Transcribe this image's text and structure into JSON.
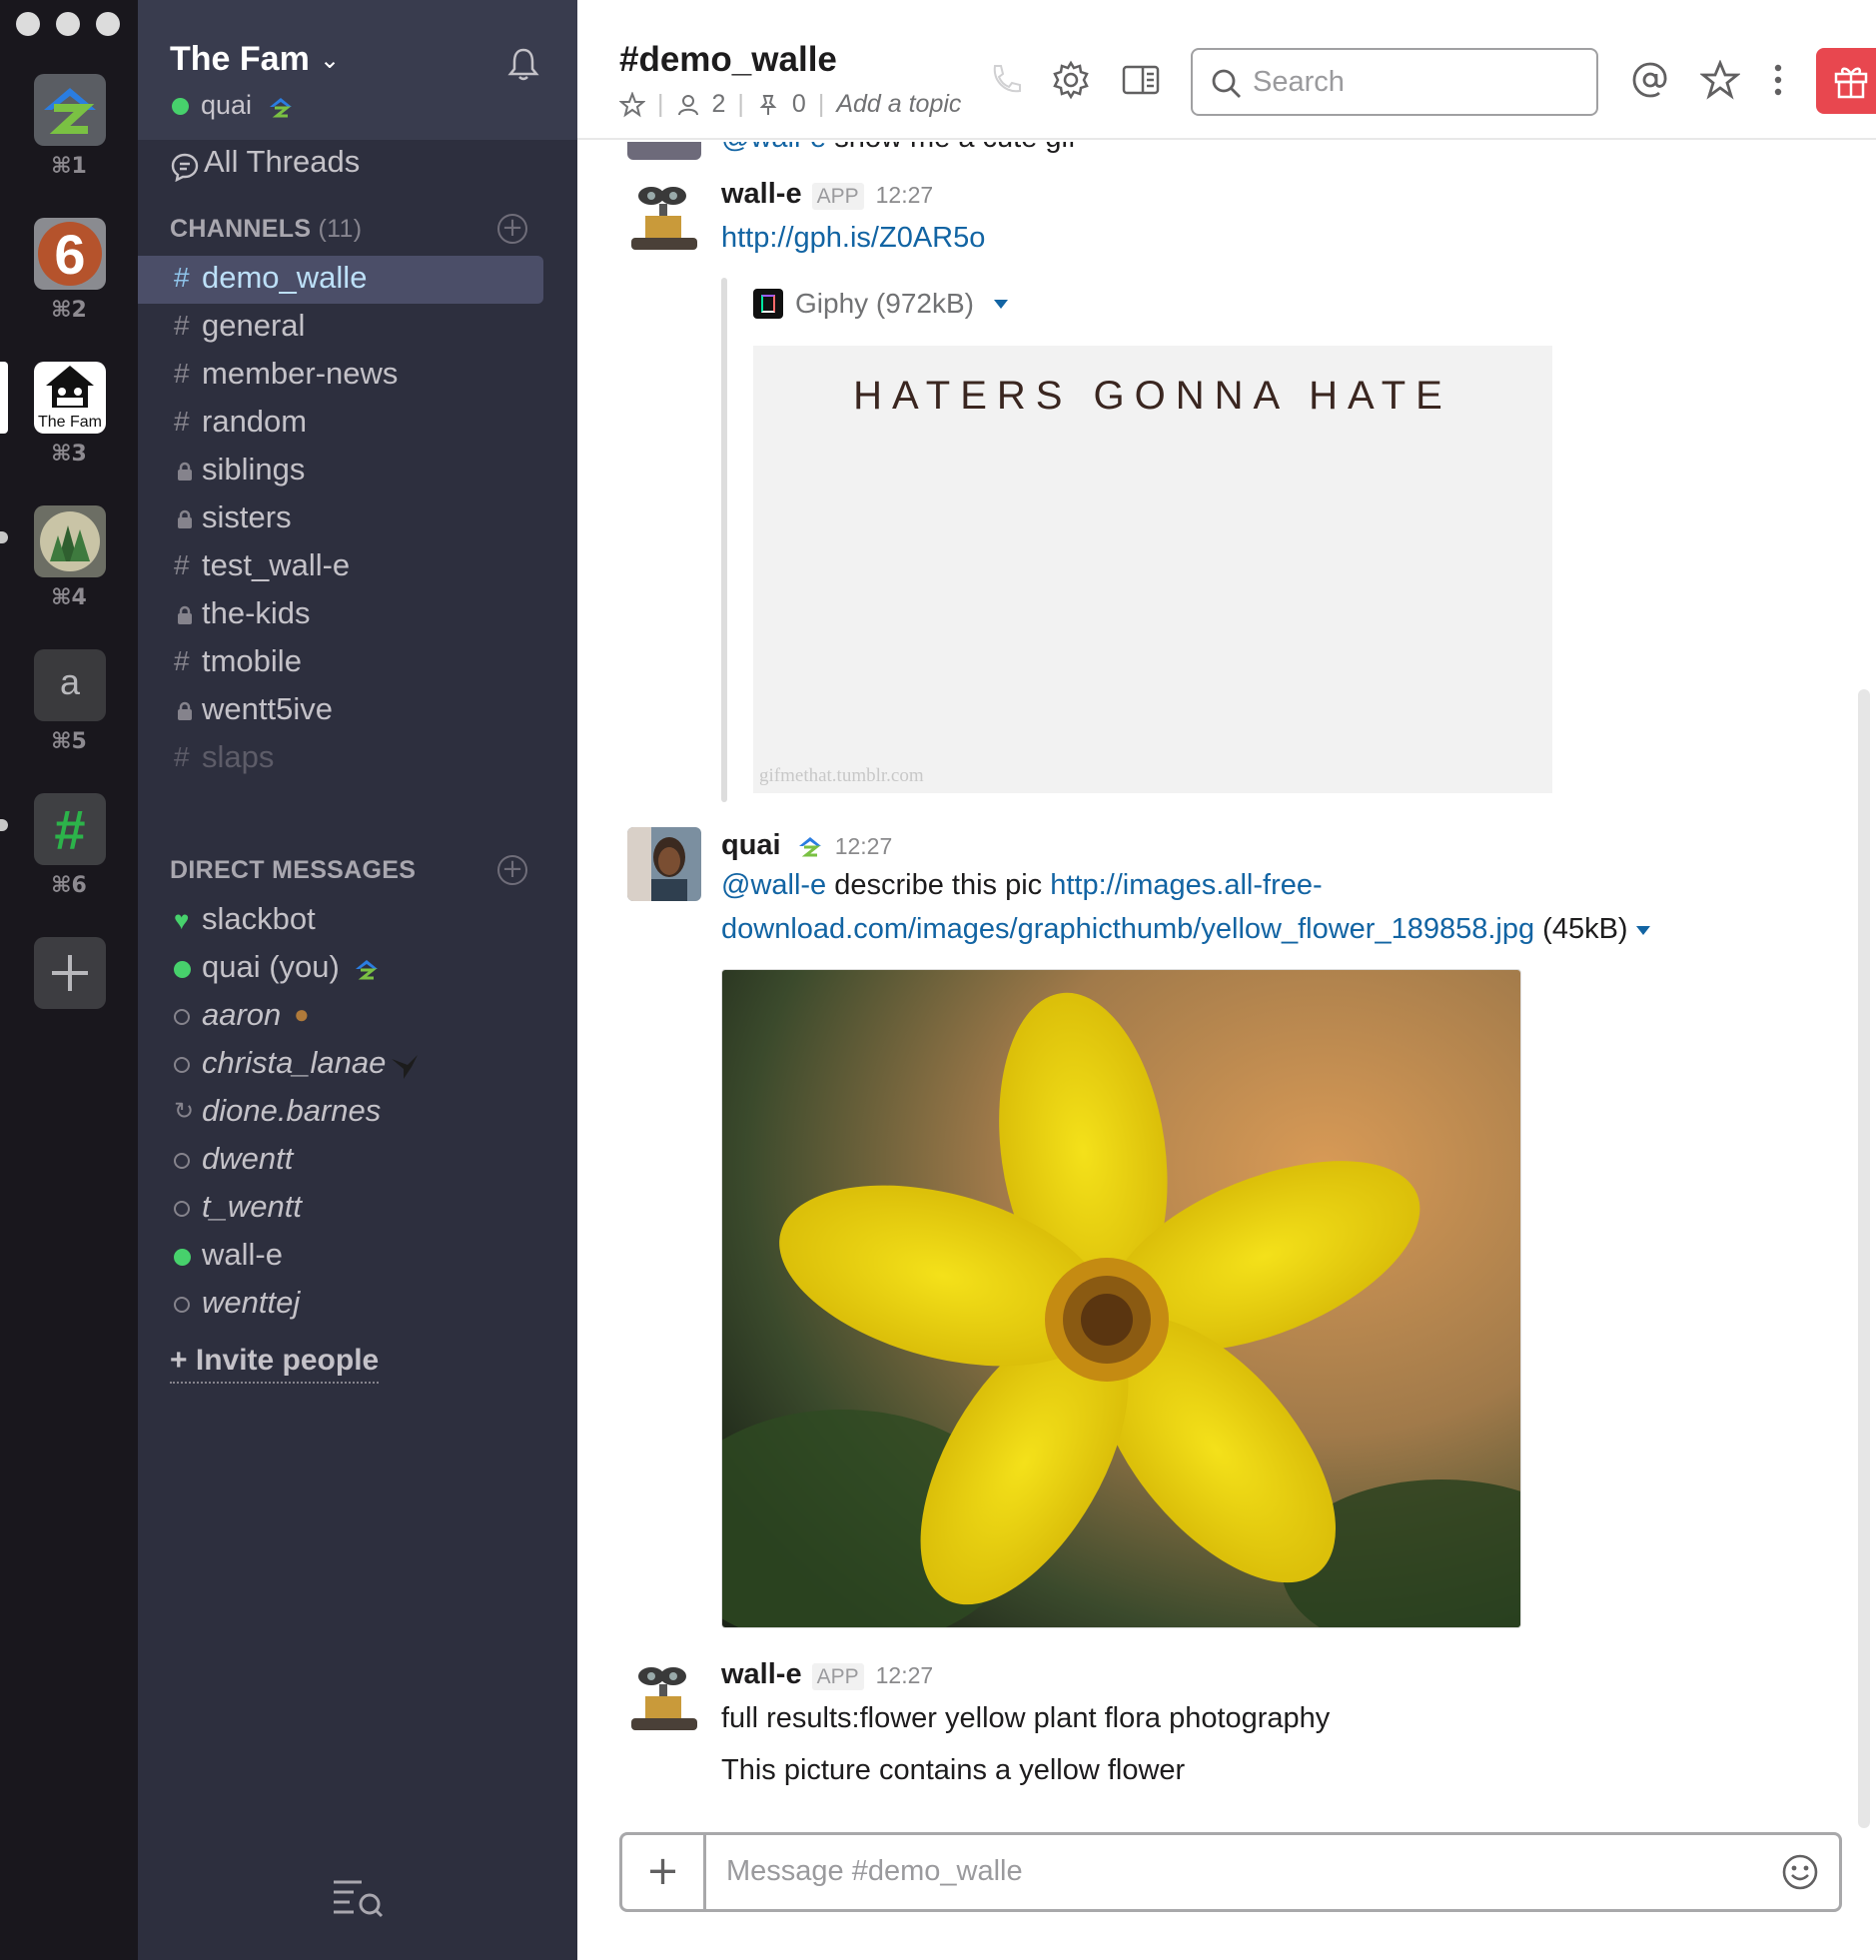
{
  "teams": [
    {
      "key": "⌘1"
    },
    {
      "key": "⌘2",
      "badge": "6"
    },
    {
      "key": "⌘3",
      "label": "The Fam"
    },
    {
      "key": "⌘4"
    },
    {
      "key": "⌘5",
      "letter": "a"
    },
    {
      "key": "⌘6",
      "letter": "#"
    }
  ],
  "sidebar": {
    "team_name": "The Fam",
    "user": "quai",
    "all_threads": "All Threads",
    "channels_title": "CHANNELS",
    "channels_count": "(11)",
    "channels": [
      {
        "prefix": "#",
        "name": "demo_walle",
        "active": true
      },
      {
        "prefix": "#",
        "name": "general"
      },
      {
        "prefix": "#",
        "name": "member-news"
      },
      {
        "prefix": "#",
        "name": "random"
      },
      {
        "prefix": "lock",
        "name": "siblings"
      },
      {
        "prefix": "lock",
        "name": "sisters"
      },
      {
        "prefix": "#",
        "name": "test_wall-e"
      },
      {
        "prefix": "lock",
        "name": "the-kids"
      },
      {
        "prefix": "#",
        "name": "tmobile"
      },
      {
        "prefix": "lock",
        "name": "wentt5ive"
      },
      {
        "prefix": "#",
        "name": "slaps",
        "muted": true
      }
    ],
    "dm_title": "DIRECT MESSAGES",
    "dms": [
      {
        "status": "heart",
        "name": "slackbot"
      },
      {
        "status": "online",
        "name": "quai (you)"
      },
      {
        "status": "away",
        "name": "aaron"
      },
      {
        "status": "away",
        "name": "christa_lanae"
      },
      {
        "status": "shared",
        "name": "dione.barnes"
      },
      {
        "status": "away",
        "name": "dwentt"
      },
      {
        "status": "away",
        "name": "t_wentt"
      },
      {
        "status": "online",
        "name": "wall-e"
      },
      {
        "status": "away",
        "name": "wenttej"
      }
    ],
    "invite_label": "+ Invite people"
  },
  "header": {
    "channel_title": "#demo_walle",
    "members_count": "2",
    "pins_count": "0",
    "topic_placeholder": "Add a topic",
    "search_placeholder": "Search"
  },
  "messages": {
    "partial_mention": "@wall-e",
    "partial_text": "show me a cute gif",
    "m1_author": "wall-e",
    "m1_badge": "APP",
    "m1_time": "12:27",
    "m1_link": "http://gph.is/Z0AR5o",
    "m1_attach_source": "Giphy (972kB)",
    "m1_gif_caption": "HATERS GONNA HATE",
    "m1_gif_credit": "gifmethat.tumblr.com",
    "m2_author": "quai",
    "m2_time": "12:27",
    "m2_mention": "@wall-e",
    "m2_text": "describe this pic",
    "m2_link_line1": "http://images.all-free-",
    "m2_link_line2": "download.com/images/graphicthumb/yellow_flower_189858.jpg",
    "m2_size": "(45kB)",
    "m3_author": "wall-e",
    "m3_badge": "APP",
    "m3_time": "12:27",
    "m3_line1": "full results:flower yellow plant flora photography",
    "m3_line2": "This picture contains a yellow flower"
  },
  "composer": {
    "placeholder": "Message #demo_walle"
  },
  "colors": {
    "sidebar_bg": "#2d2f3e",
    "team_rail_bg": "#19171d",
    "active_channel": "#4b4e68",
    "online": "#47d16c",
    "link": "#1264a3",
    "gift": "#e8474f"
  }
}
